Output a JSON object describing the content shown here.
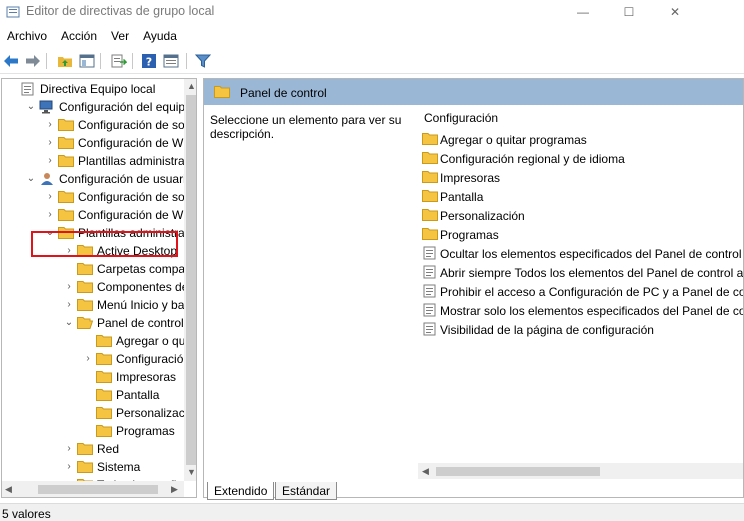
{
  "window": {
    "title": "Editor de directivas de grupo local",
    "minimize_glyph": "—",
    "maximize_glyph": "☐",
    "close_glyph": "✕"
  },
  "menu": [
    "Archivo",
    "Acción",
    "Ver",
    "Ayuda"
  ],
  "toolbar": {
    "icons": [
      "back-arrow-icon",
      "forward-arrow-icon",
      "up-folder-icon",
      "show-hide-tree-icon",
      "export-list-icon",
      "help-icon",
      "properties-icon",
      "filter-icon"
    ]
  },
  "tree": {
    "items": [
      {
        "label": "Directiva Equipo local",
        "expander": "",
        "icon": "policy"
      },
      {
        "label": "Configuración del equipo",
        "expander": "⌄",
        "icon": "computer"
      },
      {
        "label": "Configuración de softw",
        "expander": "›",
        "icon": "folder"
      },
      {
        "label": "Configuración de Winc",
        "expander": "›",
        "icon": "folder"
      },
      {
        "label": "Plantillas administrativ",
        "expander": "›",
        "icon": "folder"
      },
      {
        "label": "Configuración de usuario",
        "expander": "⌄",
        "icon": "user"
      },
      {
        "label": "Configuración de softw",
        "expander": "›",
        "icon": "folder"
      },
      {
        "label": "Configuración de Winc",
        "expander": "›",
        "icon": "folder"
      },
      {
        "label": "Plantillas administrativ",
        "expander": "⌄",
        "icon": "folder"
      },
      {
        "label": "Active Desktop",
        "expander": "›",
        "icon": "folder"
      },
      {
        "label": "Carpetas compartic",
        "expander": "",
        "icon": "folder"
      },
      {
        "label": "Componentes de W",
        "expander": "›",
        "icon": "folder"
      },
      {
        "label": "Menú Inicio y barra",
        "expander": "›",
        "icon": "folder"
      },
      {
        "label": "Panel de control",
        "expander": "⌄",
        "icon": "folder-open"
      },
      {
        "label": "Agregar o quita",
        "expander": "",
        "icon": "folder"
      },
      {
        "label": "Configuración r",
        "expander": "›",
        "icon": "folder"
      },
      {
        "label": "Impresoras",
        "expander": "",
        "icon": "folder"
      },
      {
        "label": "Pantalla",
        "expander": "",
        "icon": "folder"
      },
      {
        "label": "Personalización",
        "expander": "",
        "icon": "folder"
      },
      {
        "label": "Programas",
        "expander": "",
        "icon": "folder"
      },
      {
        "label": "Red",
        "expander": "›",
        "icon": "folder"
      },
      {
        "label": "Sistema",
        "expander": "›",
        "icon": "folder"
      },
      {
        "label": "Todas las config",
        "expander": "",
        "icon": "folder"
      }
    ]
  },
  "details": {
    "header_title": "Panel de control",
    "description": "Seleccione un elemento para ver su descripción.",
    "column_header": "Configuración",
    "rows": [
      {
        "label": "Agregar o quitar programas",
        "icon": "folder"
      },
      {
        "label": "Configuración regional y de idioma",
        "icon": "folder"
      },
      {
        "label": "Impresoras",
        "icon": "folder"
      },
      {
        "label": "Pantalla",
        "icon": "folder"
      },
      {
        "label": "Personalización",
        "icon": "folder"
      },
      {
        "label": "Programas",
        "icon": "folder"
      },
      {
        "label": "Ocultar los elementos especificados del Panel de control",
        "icon": "policy"
      },
      {
        "label": "Abrir siempre Todos los elementos del Panel de control al a",
        "icon": "policy"
      },
      {
        "label": "Prohibir el acceso a Configuración de PC y a Panel de cont",
        "icon": "policy"
      },
      {
        "label": "Mostrar solo los elementos especificados del Panel de cont",
        "icon": "policy"
      },
      {
        "label": "Visibilidad de la página de configuración",
        "icon": "policy"
      }
    ]
  },
  "tabs": [
    "Extendido",
    "Estándar"
  ],
  "status": "5 valores",
  "colors": {
    "header_bg": "#9bb7d6",
    "highlight_border": "#e0131b",
    "folder_yellow": "#f5c542"
  }
}
